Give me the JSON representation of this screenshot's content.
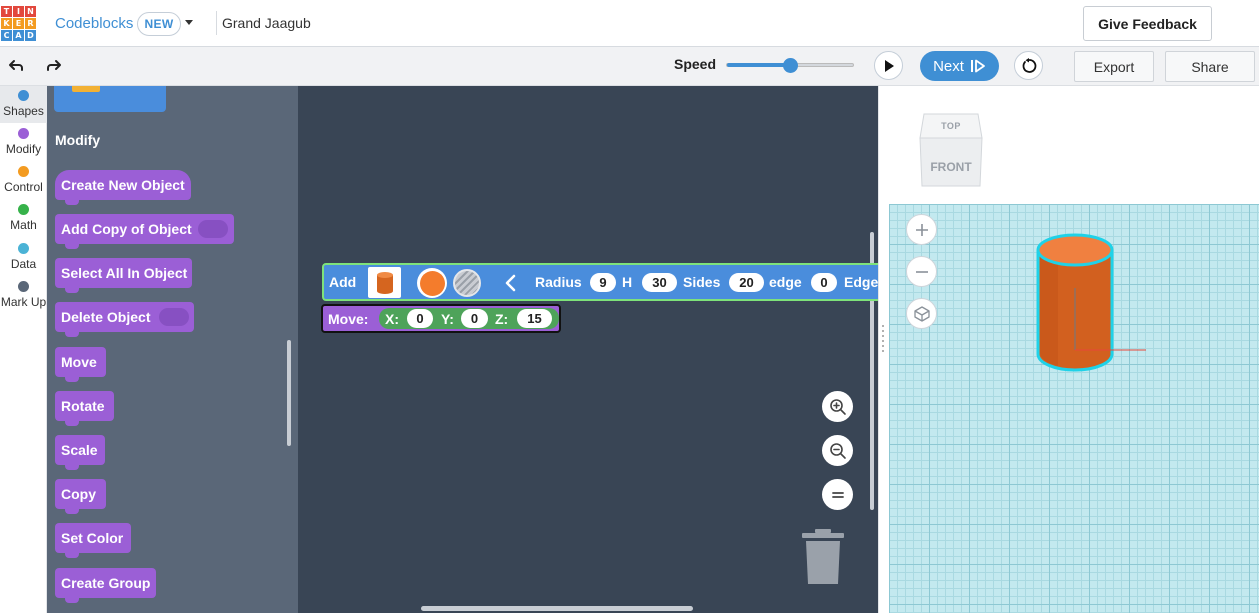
{
  "header": {
    "logo_letters": [
      "T",
      "I",
      "N",
      "K",
      "E",
      "R",
      "C",
      "A",
      "D"
    ],
    "logo_colors": [
      "#e2483d",
      "#e2483d",
      "#e2483d",
      "#f39b21",
      "#f39b21",
      "#f39b21",
      "#3f8fd4",
      "#3f8fd4",
      "#3f8fd4"
    ],
    "app_name": "Codeblocks",
    "badge": "NEW",
    "design_name": "Grand Jaagub",
    "feedback_label": "Give Feedback"
  },
  "toolbar": {
    "speed_label": "Speed",
    "speed_value": 0.5,
    "next_label": "Next",
    "export_label": "Export",
    "share_label": "Share"
  },
  "categories": [
    {
      "label": "Shapes",
      "color": "#3f8fd4"
    },
    {
      "label": "Modify",
      "color": "#9b5fd6"
    },
    {
      "label": "Control",
      "color": "#f39b21"
    },
    {
      "label": "Math",
      "color": "#36b24a"
    },
    {
      "label": "Data",
      "color": "#4bb3d6"
    },
    {
      "label": "Mark Up",
      "color": "#5a6778"
    }
  ],
  "palette": {
    "section_title": "Modify",
    "blocks": [
      "Create New Object",
      "Add Copy of Object",
      "Select All In Object",
      "Delete Object",
      "Move",
      "Rotate",
      "Scale",
      "Copy",
      "Set Color",
      "Create Group"
    ]
  },
  "workspace": {
    "add_block": {
      "add_label": "Add",
      "radius_label": "Radius",
      "radius": "9",
      "h_label": "H",
      "h": "30",
      "sides_label": "Sides",
      "sides": "20",
      "edge_label": "edge",
      "edge": "0",
      "edge2_label": "Edge",
      "color": "#f47c2c"
    },
    "move_block": {
      "label": "Move:",
      "x_label": "X:",
      "x": "0",
      "y_label": "Y:",
      "y": "0",
      "z_label": "Z:",
      "z": "15"
    }
  },
  "view3d": {
    "cube_top": "TOP",
    "cube_front": "FRONT",
    "object_color": "#e8722a",
    "outline_color": "#1fd2e8"
  }
}
